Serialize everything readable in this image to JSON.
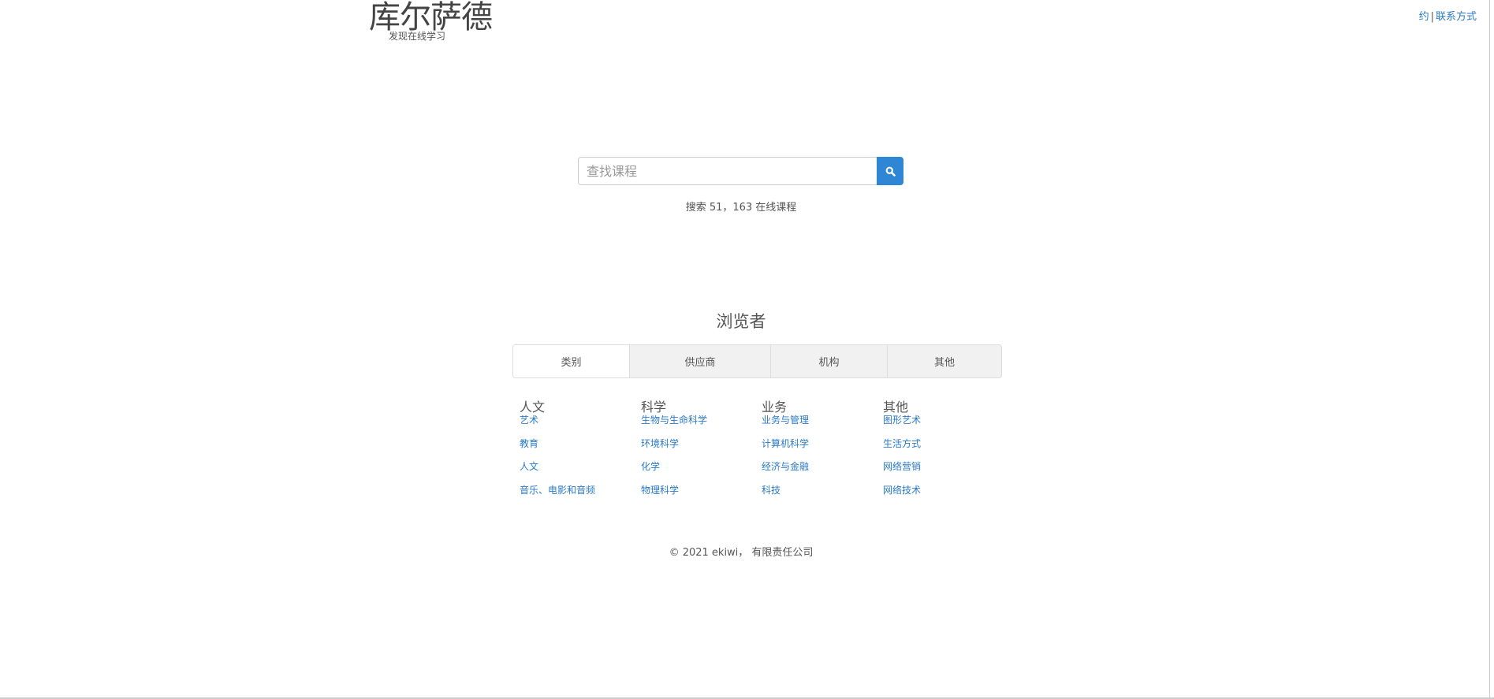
{
  "header": {
    "logo": "库尔萨德",
    "tagline": "发现在线学习",
    "links": [
      "约",
      "联系方式"
    ],
    "separator": "|"
  },
  "search": {
    "placeholder": "查找课程",
    "value": "",
    "button_icon": "search-icon",
    "count_text": "搜索 51，163 在线课程"
  },
  "browse": {
    "title": "浏览者",
    "tabs": [
      {
        "label": "类别",
        "active": true
      },
      {
        "label": "供应商"
      },
      {
        "label": "机构"
      },
      {
        "label": "其他"
      }
    ]
  },
  "categories": [
    {
      "heading": "人文",
      "items": [
        "艺术",
        "教育",
        "人文",
        "音乐、电影和音频"
      ]
    },
    {
      "heading": "科学",
      "items": [
        "生物与生命科学",
        "环境科学",
        "化学",
        "物理科学"
      ]
    },
    {
      "heading": "业务",
      "items": [
        "业务与管理",
        "计算机科学",
        "经济与金融",
        "科技"
      ]
    },
    {
      "heading": "其他",
      "items": [
        "图形艺术",
        "生活方式",
        "网络营销",
        "网络技术"
      ]
    }
  ],
  "footer": {
    "text": "© 2021 ekiwi， 有限责任公司"
  },
  "colors": {
    "link": "#2a7ac7",
    "accent": "#2f86d4"
  }
}
